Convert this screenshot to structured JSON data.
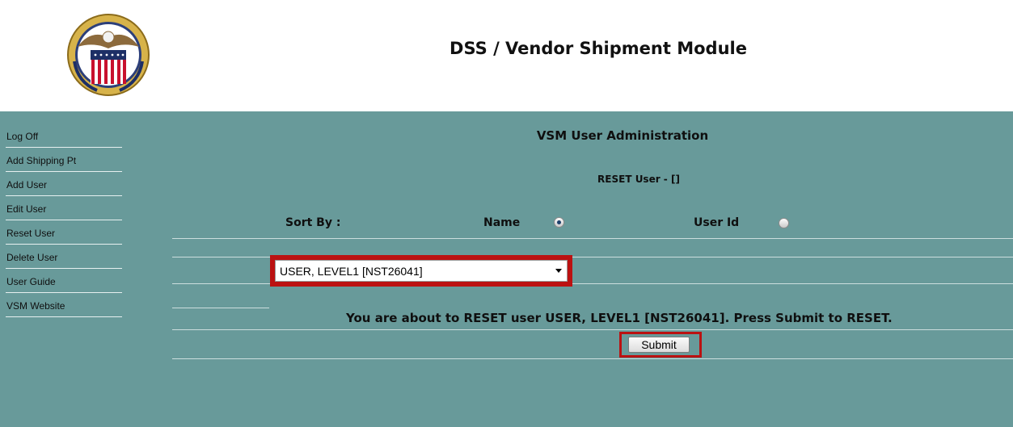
{
  "header": {
    "title": "DSS / Vendor Shipment Module",
    "logo_icon": "dla-seal-icon"
  },
  "sidebar": {
    "items": [
      {
        "label": "Log Off"
      },
      {
        "label": "Add Shipping Pt"
      },
      {
        "label": "Add User"
      },
      {
        "label": "Edit User"
      },
      {
        "label": "Reset User"
      },
      {
        "label": "Delete User"
      },
      {
        "label": "User Guide"
      },
      {
        "label": "VSM Website"
      }
    ]
  },
  "main": {
    "admin_title": "VSM User Administration",
    "reset_user_label": "RESET User - []",
    "sort_by_label": "Sort By :",
    "sort_options": [
      {
        "label": "Name",
        "checked": true
      },
      {
        "label": "User Id",
        "checked": false
      }
    ],
    "user_select": {
      "selected": "USER, LEVEL1 [NST26041]"
    },
    "message": "You are about to RESET user USER, LEVEL1 [NST26041]. Press Submit to RESET.",
    "submit_label": "Submit"
  },
  "colors": {
    "panel_bg": "#689a9a",
    "highlight_border": "#bb1111"
  }
}
